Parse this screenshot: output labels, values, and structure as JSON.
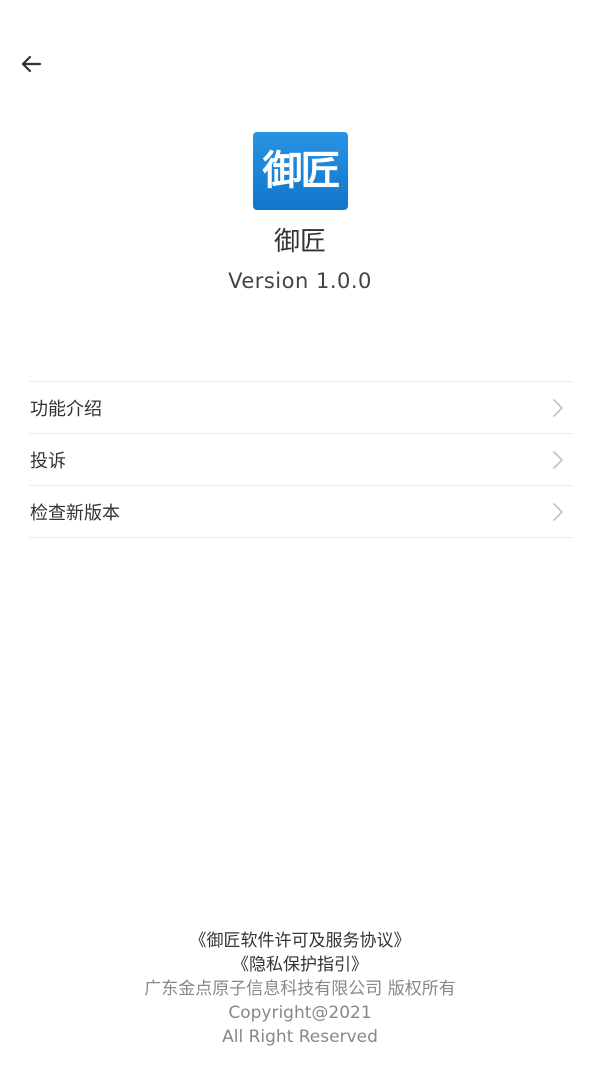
{
  "header": {
    "back_icon": "arrow-left-icon"
  },
  "app": {
    "logo_text": "御匠",
    "logo_color": "#1a85d8",
    "name": "御匠",
    "version": "Version 1.0.0"
  },
  "menu": {
    "items": [
      {
        "label": "功能介绍",
        "icon": "chevron-right-icon"
      },
      {
        "label": "投诉",
        "icon": "chevron-right-icon"
      },
      {
        "label": "检查新版本",
        "icon": "chevron-right-icon"
      }
    ]
  },
  "footer": {
    "license_link": "《御匠软件许可及服务协议》",
    "privacy_link": "《隐私保护指引》",
    "company": "广东金点原子信息科技有限公司 版权所有",
    "copyright": "Copyright@2021",
    "rights": "All Right Reserved"
  }
}
